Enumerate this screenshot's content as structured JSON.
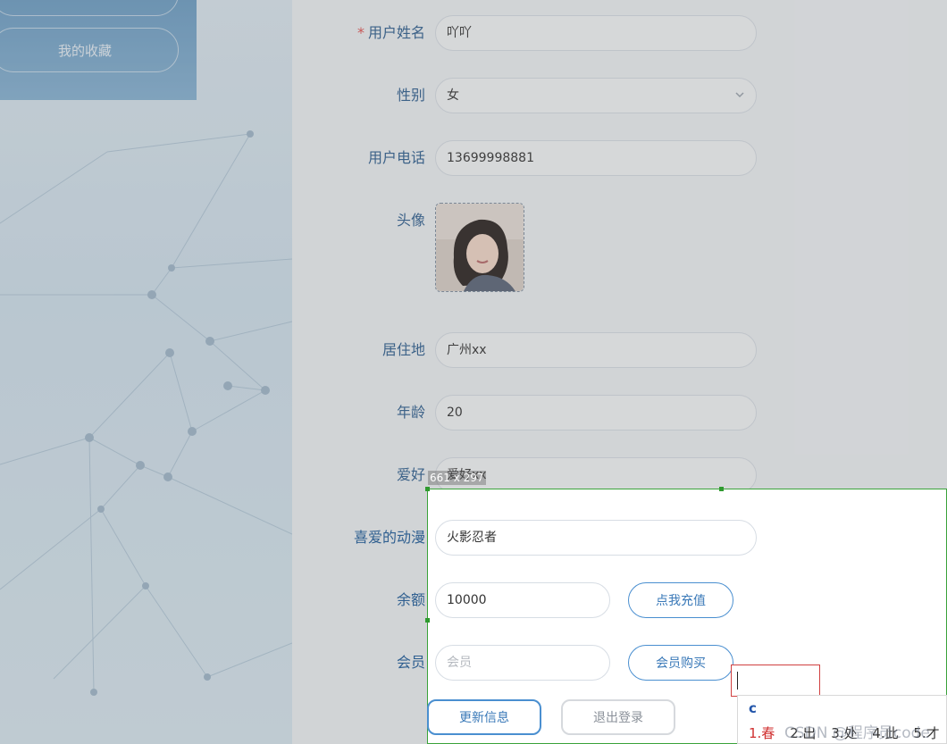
{
  "sidebar": {
    "items": [
      {
        "label": ""
      },
      {
        "label": "我的收藏"
      }
    ]
  },
  "form": {
    "username": {
      "label": "用户姓名",
      "required_mark": "*",
      "value": "吖吖"
    },
    "gender": {
      "label": "性别",
      "value": "女"
    },
    "phone": {
      "label": "用户电话",
      "value": "13699998881"
    },
    "avatar": {
      "label": "头像"
    },
    "residence": {
      "label": "居住地",
      "value": "广州xx"
    },
    "age": {
      "label": "年龄",
      "value": "20"
    },
    "hobby": {
      "label": "爱好",
      "value": "爱好xx"
    },
    "anime": {
      "label": "喜爱的动漫",
      "value": "火影忍者"
    },
    "balance": {
      "label": "余额",
      "value": "10000",
      "recharge_button": "点我充值"
    },
    "member": {
      "label": "会员",
      "placeholder": "会员",
      "buy_button": "会员购买"
    },
    "update_button": "更新信息",
    "logout_button": "退出登录"
  },
  "screenshot_tool": {
    "size_label": "661 x 297"
  },
  "ime": {
    "input": "c",
    "candidates": [
      "1.春",
      "2.出",
      "3.处",
      "4.此",
      "5.才"
    ]
  },
  "watermark": "CSDN @程序员code",
  "colors": {
    "label": "#2f5f90",
    "accent": "#4a8fd0",
    "required": "#e05252",
    "selection_border": "#3aa33a"
  }
}
